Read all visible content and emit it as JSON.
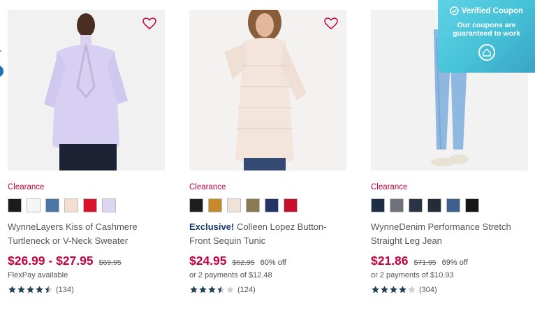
{
  "coupon": {
    "title": "Verified Coupon",
    "message": "Our coupons are guaranteed to work"
  },
  "products": [
    {
      "badge": "Clearance",
      "swatches": [
        "#1b1b1b",
        "#f6f6f4",
        "#4a76a6",
        "#f3ded0",
        "#d8132c",
        "#ddd6f3"
      ],
      "exclusive": "",
      "name": "WynneLayers Kiss of Cashmere Turtleneck or V-Neck Sweater",
      "price": "$26.99 - $27.95",
      "original": "$69.95",
      "discount": "",
      "sub": "FlexPay available",
      "rating": 4.5,
      "reviews": "(134)"
    },
    {
      "badge": "Clearance",
      "swatches": [
        "#1e1e1e",
        "#c78a2a",
        "#efe2d8",
        "#8a7a52",
        "#233567",
        "#c8102e"
      ],
      "exclusive": "Exclusive!",
      "name": "Colleen Lopez Button-Front Sequin Tunic",
      "price": "$24.95",
      "original": "$62.95",
      "discount": "60% off",
      "sub": "or 2 payments of $12.48",
      "rating": 3.5,
      "reviews": "(124)"
    },
    {
      "badge": "Clearance",
      "swatches": [
        "#1e2c44",
        "#6f7279",
        "#2b3347",
        "#252b38",
        "#3f5f8c",
        "#151515"
      ],
      "exclusive": "",
      "name": "WynneDenim Performance Stretch Straight Leg Jean",
      "price": "$21.86",
      "original": "$71.95",
      "discount": "69% off",
      "sub": "or 2 payments of $10.93",
      "rating": 4.0,
      "reviews": "(304)"
    }
  ]
}
